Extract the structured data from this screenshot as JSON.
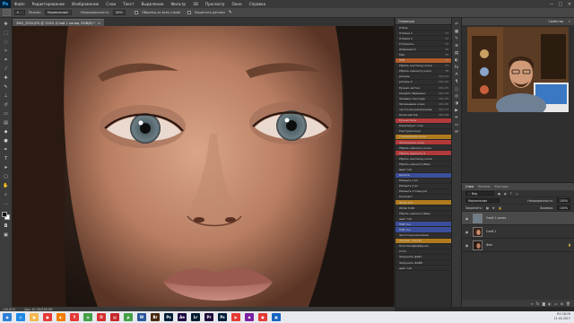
{
  "app": {
    "logo": "Ps"
  },
  "menubar": {
    "items": [
      "Файл",
      "Редактирование",
      "Изображение",
      "Слои",
      "Текст",
      "Выделение",
      "Фильтр",
      "3D",
      "Просмотр",
      "Окно",
      "Справка"
    ],
    "window_controls": [
      "—",
      "□",
      "✕"
    ]
  },
  "options_bar": {
    "label_mode": "Режим:",
    "mode_value": "Нормальный",
    "label_opacity": "Непрозрачность:",
    "opacity_value": "50%",
    "sample_all": "Образец со всех слоев",
    "protect_detail": "Защитить детали"
  },
  "document": {
    "tab_title": "3MG_2550.JPG @ 150% (Слой 1 копия, RGB/8) *",
    "close_icon": "×"
  },
  "status_bar": {
    "zoom": "149,62%",
    "doc": "Док: 62,3M/356,9M"
  },
  "actions_panel": {
    "title": "Операции",
    "rows": [
      {
        "label": "Отбор",
        "key": ""
      },
      {
        "label": "Отмена 1",
        "key": "F1"
      },
      {
        "label": "Отмена 2",
        "key": "F2"
      },
      {
        "label": "Устранить",
        "key": "F3"
      },
      {
        "label": "Операция 2",
        "key": "F4"
      },
      {
        "label": "Мяч",
        "key": "F5"
      },
      {
        "label": "HSB",
        "key": "F6"
      },
      {
        "label": "Убрать желтизну кожи",
        "key": "F7"
      },
      {
        "label": "Убрать красноту кожи",
        "key": "F8"
      },
      {
        "label": "ретушь",
        "key": "Ctrl+F1"
      },
      {
        "label": "ретушь 2",
        "key": "Ctrl+F2"
      },
      {
        "label": "Ручная чистка",
        "key": "Ctrl+F3"
      },
      {
        "label": "Сводить Фреквенс",
        "key": "Ctrl+F4"
      },
      {
        "label": "Заливка текстуры",
        "key": "Ctrl+F5"
      },
      {
        "label": "Затемнение кожи",
        "key": "Ctrl+F6"
      },
      {
        "label": "частотное разложение",
        "key": "Ctrl+F7"
      },
      {
        "label": "Кожа мастер",
        "key": "Ctrl+F8"
      },
      {
        "label": "Ручная бель",
        "key": ""
      },
      {
        "label": "Коригирует стан",
        "key": ""
      },
      {
        "label": "Текстура кожи",
        "key": ""
      },
      {
        "label": "Тонирование кожи",
        "key": ""
      },
      {
        "label": "Запоминать кожу",
        "key": ""
      },
      {
        "label": "Убрать красноту кожи",
        "key": ""
      },
      {
        "label": "Убрать красноту 2",
        "key": ""
      },
      {
        "label": "Убрать желтизну кожи",
        "key": ""
      },
      {
        "label": "Убрать красноту Baby",
        "key": ""
      },
      {
        "label": "Цвет тоб",
        "key": ""
      },
      {
        "label": "Белила",
        "key": ""
      },
      {
        "label": "Размыть 1 px",
        "key": ""
      },
      {
        "label": "Размыть 2 px",
        "key": ""
      },
      {
        "label": "Размыть столкнули",
        "key": ""
      },
      {
        "label": "Контраст",
        "key": ""
      },
      {
        "label": "White Тоб",
        "key": ""
      },
      {
        "label": "White Тоб8",
        "key": ""
      },
      {
        "label": "Убрать красноту Baby",
        "key": ""
      },
      {
        "label": "цвет тоб",
        "key": ""
      },
      {
        "label": "HSB тон",
        "key": ""
      },
      {
        "label": "HSB тон",
        "key": ""
      },
      {
        "label": "Частотное разложен",
        "key": ""
      },
      {
        "label": "Основа - Conrall",
        "key": ""
      },
      {
        "label": "Пластика/Диффузия",
        "key": ""
      },
      {
        "label": "Стоп",
        "key": ""
      },
      {
        "label": "Загрузить файл",
        "key": ""
      },
      {
        "label": "Загрузить ФАЙЛ",
        "key": ""
      },
      {
        "label": "цвет тоб",
        "key": ""
      }
    ],
    "row_colors": [
      "#2e2e2e",
      "#2e2e2e",
      "#2e2e2e",
      "#2e2e2e",
      "#2e2e2e",
      "#2e2e2e",
      "#b05a2a",
      "#2e2e2e",
      "#2e2e2e",
      "#2e2e2e",
      "#2e2e2e",
      "#2e2e2e",
      "#2e2e2e",
      "#2e2e2e",
      "#2e2e2e",
      "#2e2e2e",
      "#2e2e2e",
      "#b23a3a",
      "#2e2e2e",
      "#2e2e2e",
      "#b07a1e",
      "#b23a3a",
      "#2e2e2e",
      "#b23a3a",
      "#2e2e2e",
      "#2e2e2e",
      "#2e2e2e",
      "#3c4e9a",
      "#2e2e2e",
      "#2e2e2e",
      "#2e2e2e",
      "#2e2e2e",
      "#b07a1e",
      "#2e2e2e",
      "#2e2e2e",
      "#2e2e2e",
      "#3c4e9a",
      "#3c4e9a",
      "#2e2e2e",
      "#b07a1e",
      "#2e2e2e",
      "#2e2e2e",
      "#2e2e2e",
      "#2e2e2e",
      "#2e2e2e"
    ]
  },
  "right_panel": {
    "header_tabs": [
      "Свойства",
      "»"
    ],
    "layers": {
      "tabs": [
        "Слои",
        "Каналы",
        "Контуры"
      ],
      "filter_label": "Вид",
      "blend_mode": "Нормальные",
      "opacity_label": "Непрозрачность:",
      "opacity_value": "100%",
      "lock_label": "Закрепить:",
      "fill_label": "Заливка:",
      "fill_value": "100%",
      "items": [
        {
          "name": "Слой 1 копия",
          "selected": true
        },
        {
          "name": "Слой 1",
          "selected": false
        },
        {
          "name": "Фон",
          "selected": false
        }
      ]
    }
  },
  "taskbar": {
    "buttons": [
      {
        "icon": "start-icon",
        "glyph": "◉",
        "color": "#2d7fd8"
      },
      {
        "icon": "browser-icon",
        "glyph": "◎",
        "color": "#1e88e5"
      },
      {
        "icon": "folder-icon",
        "glyph": "▣",
        "color": "#f2b84b"
      },
      {
        "icon": "camera-icon",
        "glyph": "●",
        "color": "#e53935"
      },
      {
        "icon": "firefox-icon",
        "glyph": "◐",
        "color": "#f57c00"
      },
      {
        "icon": "yandex-icon",
        "glyph": "Y",
        "color": "#e53935"
      },
      {
        "icon": "chrome-icon",
        "glyph": "◍",
        "color": "#43a047"
      },
      {
        "icon": "opera-icon",
        "glyph": "O",
        "color": "#d32f2f"
      },
      {
        "icon": "pdf-icon",
        "glyph": "▤",
        "color": "#c62828"
      },
      {
        "icon": "torrent-icon",
        "glyph": "μ",
        "color": "#43a047"
      },
      {
        "icon": "word-icon",
        "glyph": "W",
        "color": "#2b579a"
      },
      {
        "icon": "bridge-icon",
        "glyph": "Br",
        "color": "#4a2a10"
      },
      {
        "icon": "photoshop-icon",
        "glyph": "Ps",
        "color": "#001e36"
      },
      {
        "icon": "after-effects-icon",
        "glyph": "Ae",
        "color": "#1f0740"
      },
      {
        "icon": "lightroom-icon",
        "glyph": "Lr",
        "color": "#001a2d"
      },
      {
        "icon": "premiere-icon",
        "glyph": "Pr",
        "color": "#1e0a3a"
      },
      {
        "icon": "photoshop-2-icon",
        "glyph": "Ps",
        "color": "#001e36"
      },
      {
        "icon": "video-icon",
        "glyph": "▶",
        "color": "#e53935"
      },
      {
        "icon": "media-icon",
        "glyph": "◆",
        "color": "#7b1fa2"
      },
      {
        "icon": "recorder-icon",
        "glyph": "●",
        "color": "#e53935"
      },
      {
        "icon": "explorer-icon",
        "glyph": "▣",
        "color": "#1565c0"
      }
    ],
    "tray_lang": "RU",
    "time": "18:29",
    "date": "11.02.2017"
  }
}
